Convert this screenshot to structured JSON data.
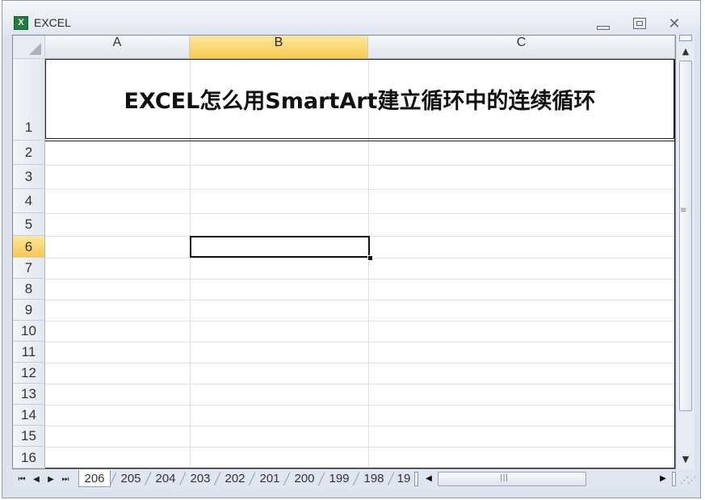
{
  "window": {
    "title": "EXCEL",
    "app_icon": "excel-icon",
    "minimize_icon": "minimize-icon",
    "restore_icon": "restore-icon",
    "close_icon": "close-icon"
  },
  "columns": [
    {
      "label": "A",
      "selected": false
    },
    {
      "label": "B",
      "selected": true
    },
    {
      "label": "C",
      "selected": false
    }
  ],
  "rows": [
    {
      "label": "1",
      "selected": false
    },
    {
      "label": "2",
      "selected": false
    },
    {
      "label": "3",
      "selected": false
    },
    {
      "label": "4",
      "selected": false
    },
    {
      "label": "5",
      "selected": false
    },
    {
      "label": "6",
      "selected": true
    },
    {
      "label": "7",
      "selected": false
    },
    {
      "label": "8",
      "selected": false
    },
    {
      "label": "9",
      "selected": false
    },
    {
      "label": "10",
      "selected": false
    },
    {
      "label": "11",
      "selected": false
    },
    {
      "label": "12",
      "selected": false
    },
    {
      "label": "13",
      "selected": false
    },
    {
      "label": "14",
      "selected": false
    },
    {
      "label": "15",
      "selected": false
    },
    {
      "label": "16",
      "selected": false
    }
  ],
  "cells": {
    "A1": "EXCEL怎么用SmartArt建立循环中的连续循环"
  },
  "selection": {
    "active_cell": "B6"
  },
  "sheet_tabs": [
    "206",
    "205",
    "204",
    "203",
    "202",
    "201",
    "200",
    "199",
    "198",
    "19"
  ],
  "sheet_nav": {
    "first": "⏮",
    "prev": "◀",
    "next": "▶",
    "last": "⏭"
  },
  "scroll": {
    "up": "▲",
    "down": "▼",
    "left": "◀",
    "right": "▶"
  }
}
